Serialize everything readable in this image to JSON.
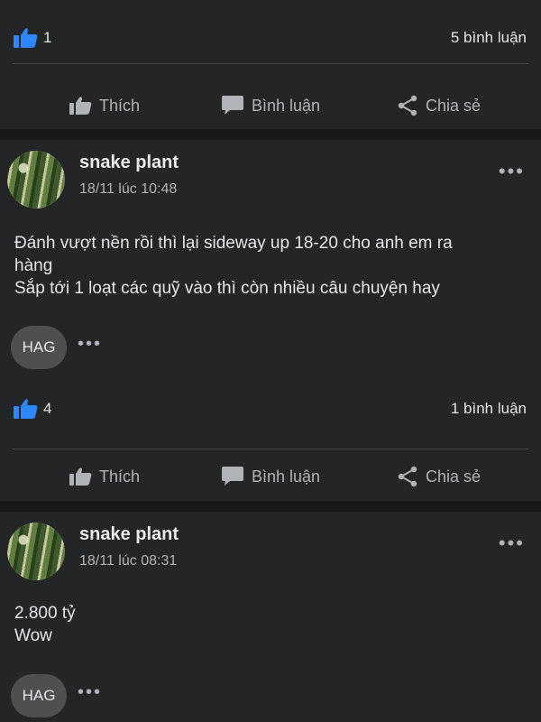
{
  "top_post": {
    "likes": "1",
    "comments": "5 bình luận"
  },
  "actions": {
    "like": "Thích",
    "comment": "Bình luận",
    "share": "Chia sẻ"
  },
  "post1": {
    "author": "snake plant",
    "time": "18/11 lúc 10:48",
    "line1": "Đánh vượt nền rồi thì lại sideway up 18-20 cho anh em ra",
    "line2": "hàng",
    "line3": "Sắp tới 1 loạt các quỹ vào thì còn nhiều câu chuyện hay",
    "tag": "HAG",
    "likes": "4",
    "comments": "1 bình luận"
  },
  "post2": {
    "author": "snake plant",
    "time": "18/11 lúc 08:31",
    "line1": "2.800 tỷ",
    "line2": "Wow",
    "tag": "HAG"
  },
  "colors": {
    "background": "#18191a",
    "card": "#242526",
    "like_blue": "#2d88ff",
    "text": "#e4e6eb",
    "muted": "#b0b3b8"
  },
  "icons": [
    "thumbs-up-icon",
    "comment-icon",
    "share-icon",
    "more-dots-icon"
  ]
}
